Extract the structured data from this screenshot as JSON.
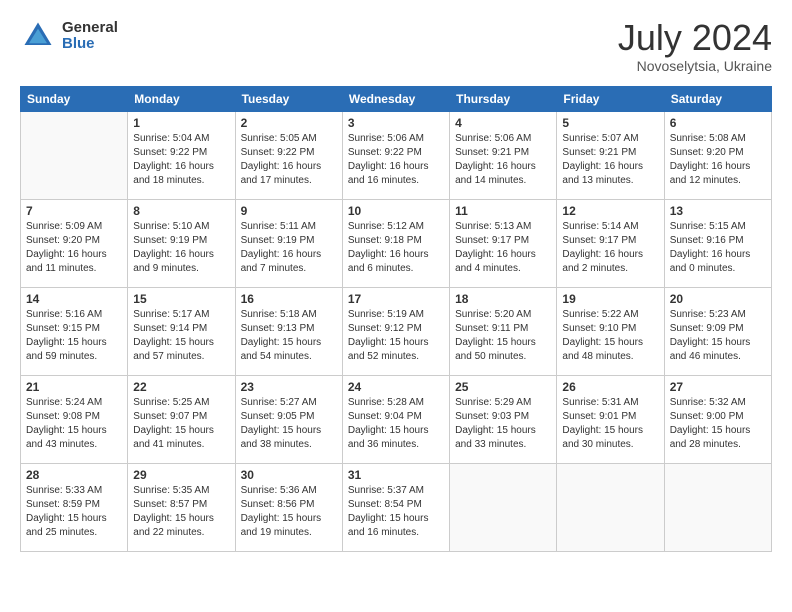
{
  "header": {
    "logo_general": "General",
    "logo_blue": "Blue",
    "month_title": "July 2024",
    "location": "Novoselytsia, Ukraine"
  },
  "calendar": {
    "headers": [
      "Sunday",
      "Monday",
      "Tuesday",
      "Wednesday",
      "Thursday",
      "Friday",
      "Saturday"
    ],
    "weeks": [
      [
        {
          "day": "",
          "info": ""
        },
        {
          "day": "1",
          "info": "Sunrise: 5:04 AM\nSunset: 9:22 PM\nDaylight: 16 hours\nand 18 minutes."
        },
        {
          "day": "2",
          "info": "Sunrise: 5:05 AM\nSunset: 9:22 PM\nDaylight: 16 hours\nand 17 minutes."
        },
        {
          "day": "3",
          "info": "Sunrise: 5:06 AM\nSunset: 9:22 PM\nDaylight: 16 hours\nand 16 minutes."
        },
        {
          "day": "4",
          "info": "Sunrise: 5:06 AM\nSunset: 9:21 PM\nDaylight: 16 hours\nand 14 minutes."
        },
        {
          "day": "5",
          "info": "Sunrise: 5:07 AM\nSunset: 9:21 PM\nDaylight: 16 hours\nand 13 minutes."
        },
        {
          "day": "6",
          "info": "Sunrise: 5:08 AM\nSunset: 9:20 PM\nDaylight: 16 hours\nand 12 minutes."
        }
      ],
      [
        {
          "day": "7",
          "info": "Sunrise: 5:09 AM\nSunset: 9:20 PM\nDaylight: 16 hours\nand 11 minutes."
        },
        {
          "day": "8",
          "info": "Sunrise: 5:10 AM\nSunset: 9:19 PM\nDaylight: 16 hours\nand 9 minutes."
        },
        {
          "day": "9",
          "info": "Sunrise: 5:11 AM\nSunset: 9:19 PM\nDaylight: 16 hours\nand 7 minutes."
        },
        {
          "day": "10",
          "info": "Sunrise: 5:12 AM\nSunset: 9:18 PM\nDaylight: 16 hours\nand 6 minutes."
        },
        {
          "day": "11",
          "info": "Sunrise: 5:13 AM\nSunset: 9:17 PM\nDaylight: 16 hours\nand 4 minutes."
        },
        {
          "day": "12",
          "info": "Sunrise: 5:14 AM\nSunset: 9:17 PM\nDaylight: 16 hours\nand 2 minutes."
        },
        {
          "day": "13",
          "info": "Sunrise: 5:15 AM\nSunset: 9:16 PM\nDaylight: 16 hours\nand 0 minutes."
        }
      ],
      [
        {
          "day": "14",
          "info": "Sunrise: 5:16 AM\nSunset: 9:15 PM\nDaylight: 15 hours\nand 59 minutes."
        },
        {
          "day": "15",
          "info": "Sunrise: 5:17 AM\nSunset: 9:14 PM\nDaylight: 15 hours\nand 57 minutes."
        },
        {
          "day": "16",
          "info": "Sunrise: 5:18 AM\nSunset: 9:13 PM\nDaylight: 15 hours\nand 54 minutes."
        },
        {
          "day": "17",
          "info": "Sunrise: 5:19 AM\nSunset: 9:12 PM\nDaylight: 15 hours\nand 52 minutes."
        },
        {
          "day": "18",
          "info": "Sunrise: 5:20 AM\nSunset: 9:11 PM\nDaylight: 15 hours\nand 50 minutes."
        },
        {
          "day": "19",
          "info": "Sunrise: 5:22 AM\nSunset: 9:10 PM\nDaylight: 15 hours\nand 48 minutes."
        },
        {
          "day": "20",
          "info": "Sunrise: 5:23 AM\nSunset: 9:09 PM\nDaylight: 15 hours\nand 46 minutes."
        }
      ],
      [
        {
          "day": "21",
          "info": "Sunrise: 5:24 AM\nSunset: 9:08 PM\nDaylight: 15 hours\nand 43 minutes."
        },
        {
          "day": "22",
          "info": "Sunrise: 5:25 AM\nSunset: 9:07 PM\nDaylight: 15 hours\nand 41 minutes."
        },
        {
          "day": "23",
          "info": "Sunrise: 5:27 AM\nSunset: 9:05 PM\nDaylight: 15 hours\nand 38 minutes."
        },
        {
          "day": "24",
          "info": "Sunrise: 5:28 AM\nSunset: 9:04 PM\nDaylight: 15 hours\nand 36 minutes."
        },
        {
          "day": "25",
          "info": "Sunrise: 5:29 AM\nSunset: 9:03 PM\nDaylight: 15 hours\nand 33 minutes."
        },
        {
          "day": "26",
          "info": "Sunrise: 5:31 AM\nSunset: 9:01 PM\nDaylight: 15 hours\nand 30 minutes."
        },
        {
          "day": "27",
          "info": "Sunrise: 5:32 AM\nSunset: 9:00 PM\nDaylight: 15 hours\nand 28 minutes."
        }
      ],
      [
        {
          "day": "28",
          "info": "Sunrise: 5:33 AM\nSunset: 8:59 PM\nDaylight: 15 hours\nand 25 minutes."
        },
        {
          "day": "29",
          "info": "Sunrise: 5:35 AM\nSunset: 8:57 PM\nDaylight: 15 hours\nand 22 minutes."
        },
        {
          "day": "30",
          "info": "Sunrise: 5:36 AM\nSunset: 8:56 PM\nDaylight: 15 hours\nand 19 minutes."
        },
        {
          "day": "31",
          "info": "Sunrise: 5:37 AM\nSunset: 8:54 PM\nDaylight: 15 hours\nand 16 minutes."
        },
        {
          "day": "",
          "info": ""
        },
        {
          "day": "",
          "info": ""
        },
        {
          "day": "",
          "info": ""
        }
      ]
    ]
  }
}
